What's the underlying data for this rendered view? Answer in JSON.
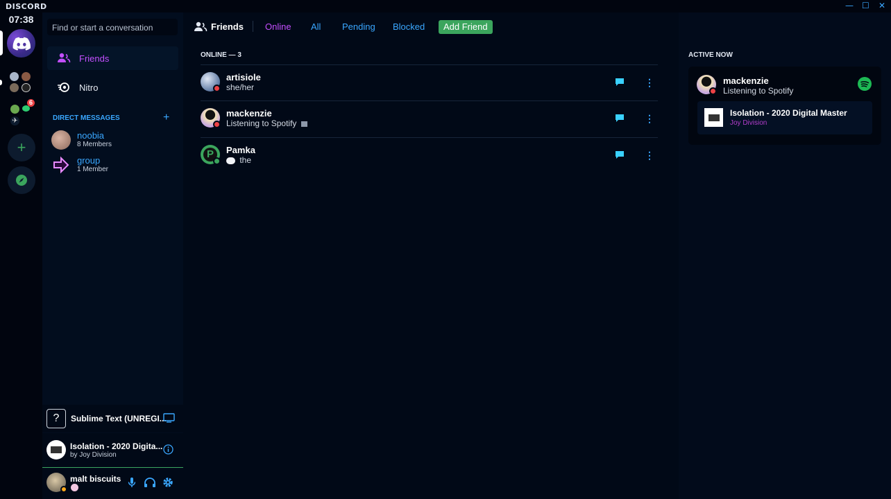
{
  "app": {
    "brand": "DISCORD"
  },
  "window": {
    "minimize": "—",
    "maximize": "☐",
    "close": "✕"
  },
  "rail": {
    "time": "07:38",
    "badge_count": "6",
    "add_label": "+"
  },
  "sidebar": {
    "search_placeholder": "Find or start a conversation",
    "nav": [
      {
        "label": "Friends"
      },
      {
        "label": "Nitro"
      }
    ],
    "dm_header": "DIRECT MESSAGES",
    "dm_add": "+",
    "dms": [
      {
        "name": "noobia",
        "sub": "8 Members"
      },
      {
        "name": "group",
        "sub": "1 Member"
      }
    ]
  },
  "activity_panel": {
    "game": "Sublime Text (UNREGI...",
    "game_icon": "?"
  },
  "music_panel": {
    "title": "Isolation - 2020 Digita...",
    "artist": "by Joy Division"
  },
  "user_panel": {
    "name": "malt biscuits"
  },
  "header": {
    "title": "Friends",
    "tabs": [
      "Online",
      "All",
      "Pending",
      "Blocked"
    ],
    "add_friend": "Add Friend"
  },
  "friends": {
    "section_title": "ONLINE — 3",
    "rows": [
      {
        "name": "artisiole",
        "status": "she/her"
      },
      {
        "name": "mackenzie",
        "status": "Listening to Spotify"
      },
      {
        "name": "Pamka",
        "status": "the"
      }
    ]
  },
  "active_now": {
    "title": "ACTIVE NOW",
    "user": "mackenzie",
    "activity": "Listening to Spotify",
    "track_title": "Isolation - 2020 Digital Master",
    "track_artist": "Joy Division"
  },
  "colors": {
    "accent": "#3aa7ff",
    "online": "#3ba55d",
    "dnd": "#ed4245",
    "tab_active": "#c34fff"
  }
}
